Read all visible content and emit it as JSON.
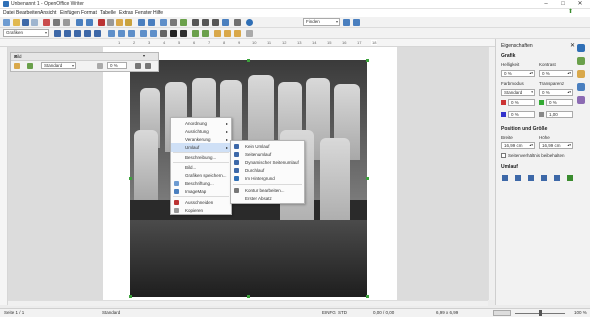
{
  "window": {
    "title": "Unbenannt 1 - OpenOffice Writer",
    "controls": [
      "–",
      "□",
      "✕"
    ]
  },
  "menubar": {
    "items": [
      "Datei",
      "Bearbeiten",
      "Ansicht",
      "Einfügen",
      "Format",
      "Tabelle",
      "Extras",
      "Fenster",
      "Hilfe"
    ]
  },
  "toolbar": {
    "find_placeholder": "Finden",
    "style_value": "Grafiken"
  },
  "ruler": {
    "labels": [
      "1",
      "2",
      "3",
      "4",
      "5",
      "6",
      "7",
      "8",
      "9",
      "10",
      "11",
      "12",
      "13",
      "14",
      "15",
      "16",
      "17",
      "18"
    ]
  },
  "picture_toolbar": {
    "title": "Bild",
    "mode_value": "Standard",
    "transparency_value": "0 %"
  },
  "context_menu": {
    "items": [
      {
        "label": "Anordnung",
        "submenu": true
      },
      {
        "label": "Ausrichtung",
        "submenu": true
      },
      {
        "label": "Verankerung",
        "submenu": true
      },
      {
        "label": "Umlauf",
        "submenu": true,
        "highlighted": true
      },
      {
        "label": "Beschreibung..."
      },
      {
        "label": "Bild..."
      },
      {
        "label": "Grafiken speichern..."
      },
      {
        "label": "Beschriftung..."
      },
      {
        "label": "ImageMap"
      },
      {
        "label": "Ausschneiden"
      },
      {
        "label": "Kopieren"
      }
    ]
  },
  "submenu": {
    "items": [
      {
        "label": "Kein Umlauf"
      },
      {
        "label": "Seitenumlauf"
      },
      {
        "label": "Dynamischer Seitenumlauf"
      },
      {
        "label": "Durchlauf"
      },
      {
        "label": "Im Hintergrund",
        "checked": true
      },
      {
        "label": "Kontur bearbeiten..."
      },
      {
        "label": "Erster Absatz"
      }
    ]
  },
  "sidebar": {
    "title": "Eigenschaften",
    "grafik": {
      "section": "Grafik",
      "brightness_label": "Helligkeit",
      "brightness_value": "0 %",
      "contrast_label": "Kontrast",
      "contrast_value": "0 %",
      "colormode_label": "Farbmodus",
      "colormode_value": "Standard",
      "transparency_label": "Transparenz",
      "transparency_value": "0 %",
      "red_value": "0 %",
      "green_value": "0 %",
      "blue_value": "0 %",
      "gamma_value": "1,00"
    },
    "position": {
      "section": "Position und Größe",
      "width_label": "Breite",
      "width_value": "16,99 cm",
      "height_label": "Höhe",
      "height_value": "16,99 cm",
      "keep_ratio_label": "Seitenverhältnis beibehalten"
    },
    "umlauf": {
      "section": "Umlauf"
    }
  },
  "statusbar": {
    "page": "Seite 1 / 1",
    "style": "Standard",
    "mode": "EINFG",
    "selmode": "STD",
    "position": "0,00 / 0,00",
    "size": "6,99 x 6,99",
    "zoom": "100 %"
  }
}
